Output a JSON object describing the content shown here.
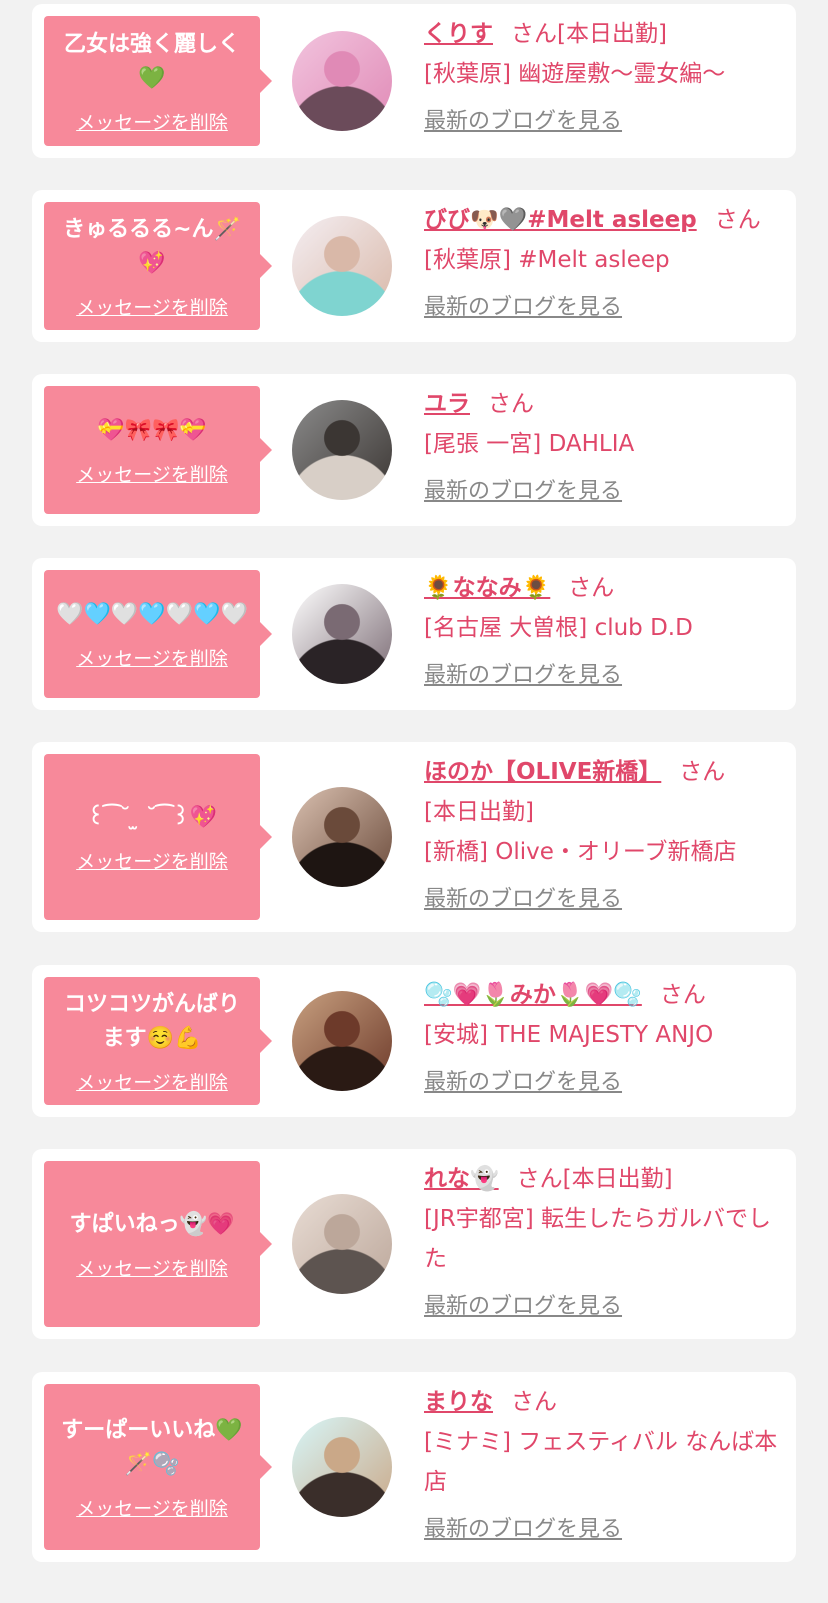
{
  "bubble_delete_label": "メッセージを削除",
  "san_label": "さん",
  "blog_link_label": "最新のブログを見る",
  "colors": {
    "background": "#f2f2f2",
    "card": "#ffffff",
    "bubble": "#f7899a",
    "name": "#e0476a",
    "link_gray": "#888888"
  },
  "entries": [
    {
      "message": "乙女は強く麗しく💚",
      "name": "くりす",
      "tag": "[本日出勤]",
      "lines": [
        "[秋葉原] 幽遊屋敷〜霊女編〜"
      ],
      "avatar_colors": [
        "#f2c4de",
        "#e08ab6",
        "#6b4b5a"
      ]
    },
    {
      "message": "きゅるるる~ん🪄💖",
      "name": "びび🐶🩶#Melt asleep",
      "tag": "",
      "lines": [
        "[秋葉原] #Melt asleep"
      ],
      "avatar_colors": [
        "#f4eef2",
        "#d9b8a8",
        "#7fd4d0"
      ]
    },
    {
      "message": "💝🎀🎀💝",
      "name": "ユラ",
      "tag": "",
      "lines": [
        "[尾張 一宮] DAHLIA"
      ],
      "avatar_colors": [
        "#8a8a8a",
        "#3b3633",
        "#d8cfc7"
      ]
    },
    {
      "message": "🤍🩵🤍🩵🤍🩵🤍",
      "name": "🌻ななみ🌻",
      "tag": "",
      "lines": [
        "[名古屋 大曽根] club D.D"
      ],
      "avatar_colors": [
        "#ffffff",
        "#7a6a73",
        "#2a2326"
      ]
    },
    {
      "message": "꒰ ͡ ˘ ̫ ˘ ͡ ꒱💖",
      "name": "ほのか【OLIVE新橋】",
      "tag": "",
      "lines": [
        "[本日出勤]",
        "[新橋] Olive・オリーブ新橋店"
      ],
      "avatar_colors": [
        "#d9c0b0",
        "#6a4a3a",
        "#1e1512"
      ]
    },
    {
      "message": "コツコツがんばります☺️💪",
      "name": "🫧💗🌷みか🌷💗🫧",
      "tag": "",
      "lines": [
        "[安城] THE MAJESTY ANJO"
      ],
      "avatar_colors": [
        "#c8a080",
        "#6d3a2a",
        "#2a1a14"
      ]
    },
    {
      "message": "すぱいねっ👻💗",
      "name": "れな👻",
      "tag": "[本日出勤]",
      "lines": [
        "[JR宇都宮] 転生したらガルバでした"
      ],
      "avatar_colors": [
        "#e8dcd4",
        "#bca79a",
        "#5d5450"
      ]
    },
    {
      "message": "すーぱーいいね💚🪄🫧",
      "name": "まりな",
      "tag": "",
      "lines": [
        "[ミナミ] フェスティバル なんば本店"
      ],
      "avatar_colors": [
        "#d7f6f8",
        "#caa888",
        "#3a2e2a"
      ]
    }
  ]
}
